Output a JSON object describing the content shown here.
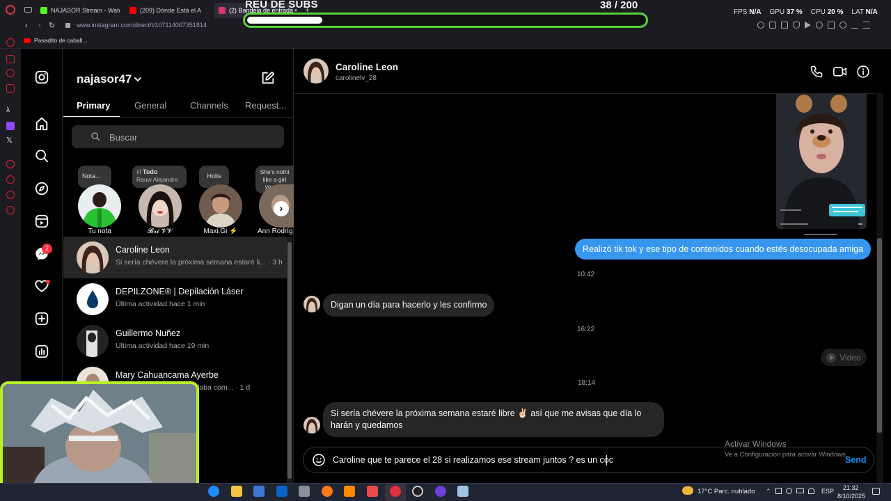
{
  "browser": {
    "tabs": [
      {
        "label": "NAJASOR Stream - Watch",
        "favicon_color": "#53fc18"
      },
      {
        "label": "(209) Dónde Está el A",
        "favicon_color": "#ff0000"
      },
      {
        "label": "(2) Bandeja de entrada •",
        "favicon_color": "#e1306c"
      }
    ],
    "url": "www.instagram.com/direct/t/107114007351814",
    "bookmark": "Pasadito de caball...",
    "new_tab_label": "+"
  },
  "overlay": {
    "subs_title": "REU DE SUBS",
    "subs_count": "38  / 200",
    "subs_progress": 0.19,
    "stats": [
      {
        "label": "FPS",
        "value": "N/A"
      },
      {
        "label": "GPU",
        "value": "37 %"
      },
      {
        "label": "CPU",
        "value": "20 %"
      },
      {
        "label": "LAT",
        "value": "N/A"
      }
    ]
  },
  "instagram": {
    "notification_count": "2",
    "inbox": {
      "username": "najasor47",
      "tabs": [
        "Primary",
        "General",
        "Channels",
        "Request..."
      ],
      "active_tab": "Primary",
      "search_placeholder": "Buscar",
      "notes": [
        {
          "bubble": "Nota...",
          "name": "Tu nota"
        },
        {
          "bubble_title": "Todo",
          "bubble_sub": "Rauw Alejandro",
          "name": "𝓑𝓻𝓲 𝓥𝓥"
        },
        {
          "bubble": "Holis",
          "name": "Maxi.Gi ⚡"
        },
        {
          "bubble": "She's nothi like a girl yo ever seen",
          "name": "Ann Rodríg"
        }
      ],
      "threads": [
        {
          "name": "Caroline Leon",
          "preview": "Si sería chévere la próxima semana estaré li... · 3 h",
          "selected": true
        },
        {
          "name": "DEPILZONE® | Depilación Láser",
          "preview": "Última actividad hace 1 min",
          "selected": false
        },
        {
          "name": "Guillermo Nuñez",
          "preview": "Última actividad hace 19 min",
          "selected": false
        },
        {
          "name": "Mary Cahuancama Ayerbe",
          "preview": "que hablaba com... · 1 d",
          "selected": false
        }
      ]
    },
    "chat": {
      "name": "Caroline Leon",
      "handle": "carolinelv_28",
      "messages": [
        {
          "from": "me",
          "text": "Realizó tik tok y ese tipo de contenidos cuando estés desocupada amiga"
        },
        {
          "time": "10:42"
        },
        {
          "from": "them",
          "text": "Digan un día para hacerlo y les confirmo"
        },
        {
          "time": "16:22"
        },
        {
          "from": "me",
          "text": "Video",
          "kind": "video"
        },
        {
          "time": "18:14"
        },
        {
          "from": "them",
          "text": "Si sería chévere la próxima semana estaré libre ✌🏻 así que me avisas que día lo harán y quedamos"
        }
      ],
      "composer_value": "Caroline que te parece el 28 si realizamos ese stream juntos ? es un coc",
      "send_label": "Send"
    }
  },
  "windows": {
    "activate_title": "Activar Windows",
    "activate_sub": "Ve a Configuración para activar Windows.",
    "weather": "17°C  Parc. nublado",
    "lang": "ESP",
    "time": "21:32",
    "date": "8/10/2025"
  }
}
